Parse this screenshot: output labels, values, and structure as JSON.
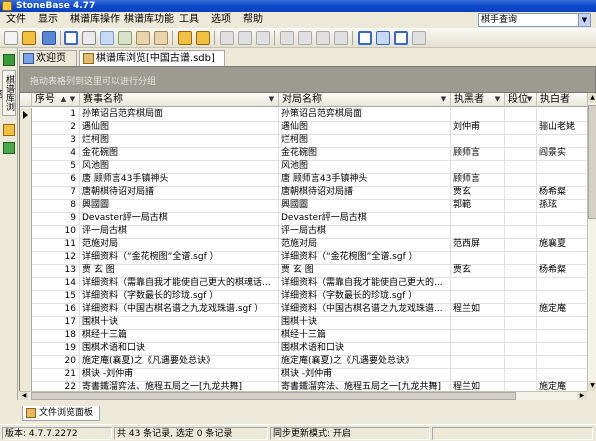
{
  "window": {
    "title": "StoneBase 4.77"
  },
  "menu": [
    "文件",
    "显示",
    "棋谱库操作",
    "棋谱库功能",
    "工具",
    "选项",
    "帮助"
  ],
  "search": {
    "value": "棋手查询"
  },
  "side_panel": {
    "tab_label": "棋谱库浏览"
  },
  "tabs": [
    {
      "label": "欢迎页",
      "active": false
    },
    {
      "label": "棋谱库浏览[中国古谱.sdb]",
      "active": true
    }
  ],
  "group_hint": "拖动表格列到这里可以进行分组",
  "columns": [
    "序号",
    "赛事名称",
    "对局名称",
    "执黑者",
    "段位",
    "执白者"
  ],
  "rows": [
    [
      "1",
      "孙策诏吕范弈棋局面",
      "孙策诏吕范弈棋局面",
      "",
      "",
      ""
    ],
    [
      "2",
      "遇仙图",
      "遇仙图",
      "刘仲甫",
      "",
      "骊山老姥"
    ],
    [
      "3",
      "烂柯图",
      "烂柯图",
      "",
      "",
      ""
    ],
    [
      "4",
      "金花碗图",
      "金花碗图",
      "顾师言",
      "",
      "阎景实"
    ],
    [
      "5",
      "风池图",
      "风池图",
      "",
      "",
      ""
    ],
    [
      "6",
      "唐 顾师言43手镇神头",
      "唐 顾师言43手镇神头",
      "顾师言",
      "",
      ""
    ],
    [
      "7",
      "唐朝棋待诏对局譜",
      "唐朝棋待诏对局譜",
      "贾玄",
      "",
      "杨希粲"
    ],
    [
      "8",
      "興國圖",
      "興國圖",
      "郭範",
      "",
      "孫玹"
    ],
    [
      "9",
      "Devaster評一局古棋",
      "Devaster評一局古棋",
      "",
      "",
      ""
    ],
    [
      "10",
      "评一局古棋",
      "评一局古棋",
      "",
      "",
      ""
    ],
    [
      "11",
      "范施对局",
      "范施对局",
      "范西屏",
      "",
      "施襄夏"
    ],
    [
      "12",
      "详细资料（“金花椀图”全谱.sgf ）",
      "详细资料（“金花椀图”全谱.sgf ）",
      "",
      "",
      ""
    ],
    [
      "13",
      "贾 玄 图",
      "贾 玄 图",
      "贾玄",
      "",
      "杨希粲"
    ],
    [
      "14",
      "详细资料（需靠自我才能使自己更大的棋魂话...",
      "详细资料（需靠自我才能使自己更大的...",
      "",
      "",
      ""
    ],
    [
      "15",
      "详细资料（字数最长的珍珑.sgf ）",
      "详细资料（字数最长的珍珑.sgf ）",
      "",
      "",
      ""
    ],
    [
      "16",
      "详细资料（中国古棋名谱之九龙戏珠谱.sgf ）",
      "详细资料（中国古棋名谱之九龙戏珠谱...",
      "程兰如",
      "",
      "施定庵"
    ],
    [
      "17",
      "围棋十诀",
      "围棋十诀",
      "",
      "",
      ""
    ],
    [
      "18",
      "棋经十三篇",
      "棋经十三篇",
      "",
      "",
      ""
    ],
    [
      "19",
      "围棋术语和口诀",
      "围棋术语和口诀",
      "",
      "",
      ""
    ],
    [
      "20",
      "施定庵(襄夏)之《凡遇要处总诀》",
      "施定庵(襄夏)之《凡遇要处总诀》",
      "",
      "",
      ""
    ],
    [
      "21",
      "棋诀 -刘仲甫",
      "棋诀 -刘仲甫",
      "",
      "",
      ""
    ],
    [
      "22",
      "寄書鐵溜弈法、施程五局之一[九龙共舞]",
      "寄書鐵溜弈法、施程五局之一[九龙共舞]",
      "程兰如",
      "",
      "施定庵"
    ]
  ],
  "bottom_panel": {
    "tab_label": "文件浏览面板"
  },
  "status": {
    "version": "版本: 4.7.7.2272",
    "records": "共 43 条记录, 选定 0 条记录",
    "sync": "同步更新模式: 开启"
  }
}
